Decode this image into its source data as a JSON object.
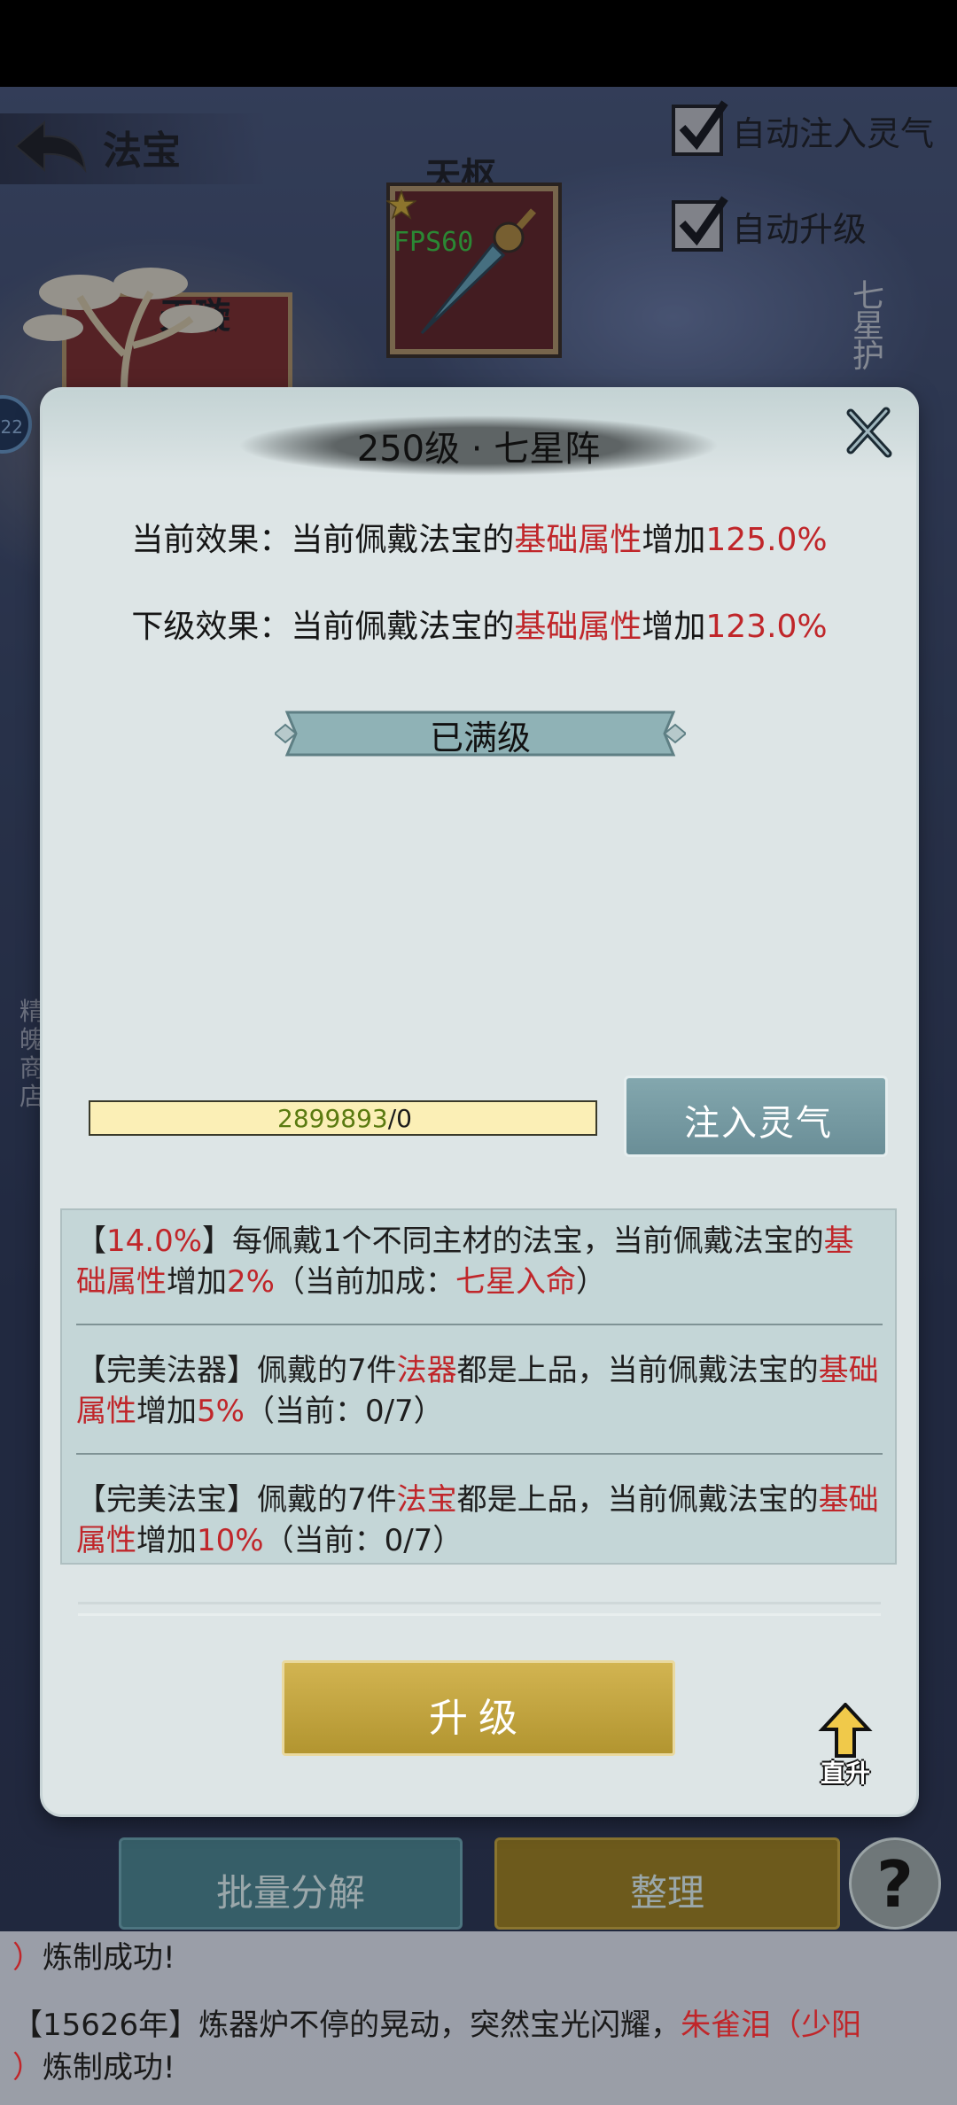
{
  "header": {
    "title": "法宝",
    "auto_inject_label": "自动注入灵气",
    "auto_upgrade_label": "自动升级"
  },
  "scene": {
    "slot_top_title": "天枢",
    "slot_left_title": "天璇",
    "fps": "FPS60",
    "side_label_right": "七星护",
    "side_label_left": "精魄商店",
    "circle_badge": "22"
  },
  "dialog": {
    "title": "250级 · 七星阵",
    "current_effect": {
      "prefix": "当前效果：当前佩戴法宝的",
      "attr": "基础属性",
      "mid": "增加",
      "value": "125.0%"
    },
    "next_effect": {
      "prefix": "下级效果：当前佩戴法宝的",
      "attr": "基础属性",
      "mid": "增加",
      "value": "123.0%"
    },
    "maxed_label": "已满级",
    "progress": {
      "current": "2899893",
      "separator": "/",
      "max": "0"
    },
    "inject_button": "注入灵气",
    "bonuses": [
      {
        "open": "【",
        "pct": "14.0%",
        "text1": "】每佩戴1个不同主材的法宝，当前佩戴法宝的",
        "attr": "基础属性",
        "text2": "增加",
        "val": "2%",
        "text3": "（当前加成：",
        "cur": "七星入命",
        "text4": "）"
      },
      {
        "text1": "【完美法器】佩戴的7件",
        "item": "法器",
        "text2": "都是上品，当前佩戴法宝的",
        "attr": "基础属性",
        "text3": "增加",
        "val": "5%",
        "text4": "（当前：0/7）"
      },
      {
        "text1": "【完美法宝】佩戴的7件",
        "item": "法宝",
        "text2": "都是上品，当前佩戴法宝的",
        "attr": "基础属性",
        "text3": "增加",
        "val": "10%",
        "text4": "（当前：0/7）"
      }
    ],
    "upgrade_button": "升级",
    "direct_up_label": "直升"
  },
  "bottom": {
    "batch_button": "批量分解",
    "sort_button": "整理",
    "help_button": "?"
  },
  "log": [
    {
      "text": "【15626年】炼器炉不停的晃动，突然宝光闪耀，",
      "item": "朱雀泪（少阳",
      "end": "）",
      "suffix": "炼制成功!"
    }
  ],
  "colors": {
    "accent_red": "#c0262a",
    "inject_teal": "#6a8e97",
    "upgrade_gold": "#b29530",
    "progress_fill": "#fbefb6"
  }
}
